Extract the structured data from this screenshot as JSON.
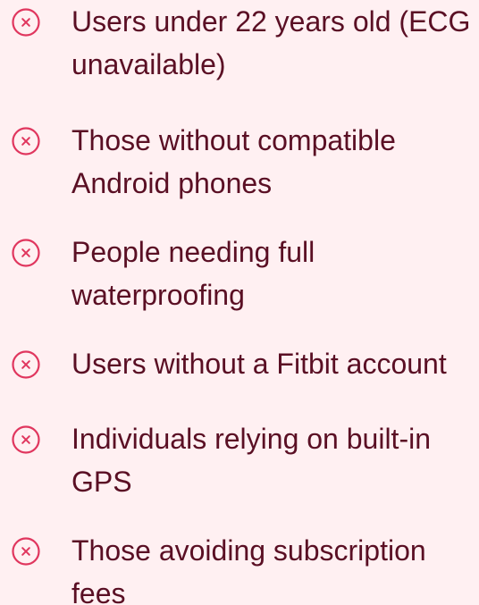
{
  "colors": {
    "background": "#fff0f2",
    "text": "#5a0f24",
    "icon": "#e0365e"
  },
  "icon": "circle-x-icon",
  "items": [
    {
      "label": "Users under 22 years old (ECG unavailable)"
    },
    {
      "label": "Those without compatible Android phones"
    },
    {
      "label": "People needing full waterproofing"
    },
    {
      "label": "Users without a Fitbit account"
    },
    {
      "label": "Individuals relying on built-in GPS"
    },
    {
      "label": "Those avoiding subscription fees"
    }
  ]
}
